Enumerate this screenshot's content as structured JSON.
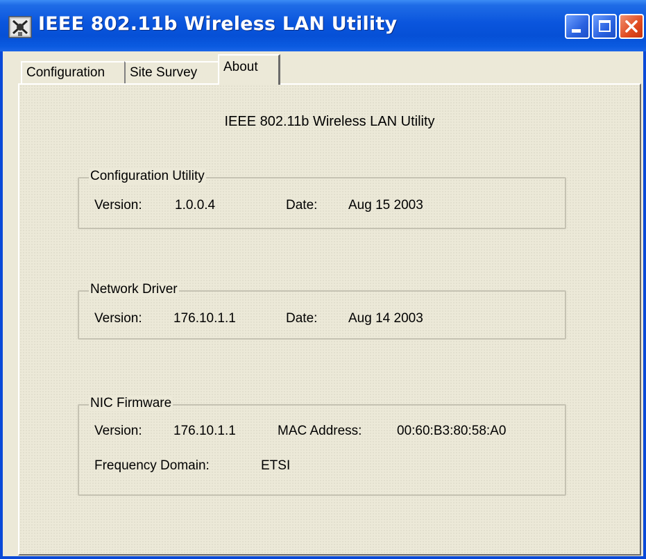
{
  "window": {
    "title": "IEEE 802.11b Wireless LAN Utility",
    "colors": {
      "titlebar": "#0a55dd",
      "close": "#e04a20",
      "face": "#ece9d8"
    }
  },
  "tabs": [
    {
      "label": "Configuration"
    },
    {
      "label": "Site Survey"
    },
    {
      "label": "About",
      "selected": true
    }
  ],
  "about": {
    "heading": "IEEE 802.11b Wireless LAN Utility",
    "config_utility": {
      "title": "Configuration Utility",
      "version_label": "Version:",
      "version": "1.0.0.4",
      "date_label": "Date:",
      "date": "Aug 15 2003"
    },
    "network_driver": {
      "title": "Network Driver",
      "version_label": "Version:",
      "version": "176.10.1.1",
      "date_label": "Date:",
      "date": "Aug 14 2003"
    },
    "nic_firmware": {
      "title": "NIC Firmware",
      "version_label": "Version:",
      "version": "176.10.1.1",
      "mac_label": "MAC Address:",
      "mac": "00:60:B3:80:58:A0",
      "freq_label": "Frequency Domain:",
      "freq": "ETSI"
    }
  }
}
